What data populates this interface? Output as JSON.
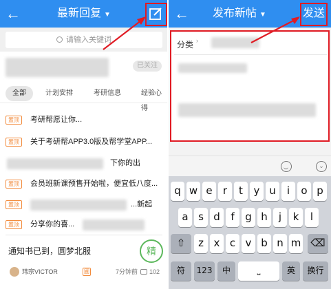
{
  "left": {
    "back_glyph": "←",
    "title": "最新回复",
    "caret": "▼",
    "search_placeholder": "请输入关键词",
    "follow_badge": "已关注",
    "tabs": [
      "全部",
      "计划安排",
      "考研信息",
      "经验心得"
    ],
    "pin_label": "置顶",
    "posts": [
      "考研帮愿让你...",
      "关于考研帮APP3.0版及帮学堂APP...",
      "下你的出",
      "会员班新课预售开始啦，便宜低八度...",
      "...新起",
      "分享你的喜..."
    ],
    "card": {
      "title": "通知书已到，圆梦北服",
      "badge": "精",
      "author": "玮宗VICTOR",
      "level": "圃",
      "time": "7分钟前",
      "comments": "102"
    }
  },
  "right": {
    "back_glyph": "←",
    "title": "发布新帖",
    "caret": "▼",
    "send": "发送",
    "category_label": "分类",
    "category_caret": "›",
    "collapse_glyph": "⌄",
    "keyboard": {
      "row1": [
        "q",
        "w",
        "e",
        "r",
        "t",
        "y",
        "u",
        "i",
        "o",
        "p"
      ],
      "row2": [
        "a",
        "s",
        "d",
        "f",
        "g",
        "h",
        "j",
        "k",
        "l"
      ],
      "row3": [
        "z",
        "x",
        "c",
        "v",
        "b",
        "n",
        "m"
      ],
      "shift": "⇧",
      "delete": "⌫",
      "bottom": [
        "符",
        "123",
        "中",
        "⎵",
        "英",
        "换行"
      ]
    }
  },
  "colors": {
    "accent": "#2f8ef0",
    "annotation_red": "#e01b24",
    "pin_orange": "#f28b3c",
    "essence_green": "#5cb85c"
  }
}
